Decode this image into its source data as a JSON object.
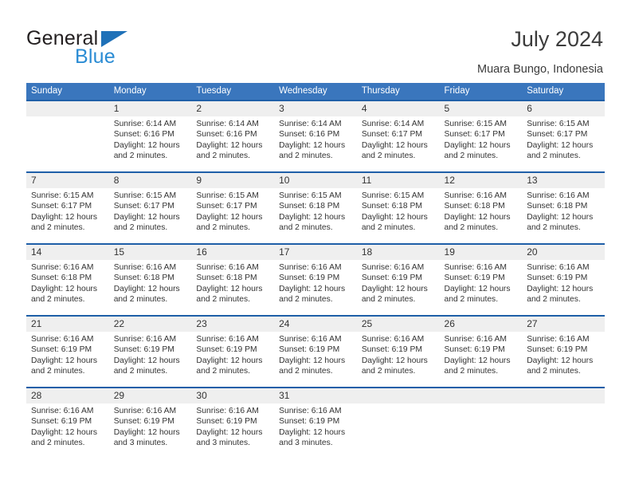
{
  "brand": {
    "name_top": "General",
    "name_bottom": "Blue",
    "triangle_icon": "blue-triangle-logo-mark",
    "color_dark": "#231f20",
    "color_blue": "#2b8cd4"
  },
  "header": {
    "title": "July 2024",
    "subtitle": "Muara Bungo, Indonesia"
  },
  "theme": {
    "header_bar": "#3a76bd",
    "cell_top_border": "#1f5fa8",
    "daynum_bg": "#efefef",
    "text": "#333333"
  },
  "calendar": {
    "weekday_headers": [
      "Sunday",
      "Monday",
      "Tuesday",
      "Wednesday",
      "Thursday",
      "Friday",
      "Saturday"
    ],
    "weeks": [
      [
        {
          "day": "",
          "blank": true,
          "lines": []
        },
        {
          "day": "1",
          "lines": [
            "Sunrise: 6:14 AM",
            "Sunset: 6:16 PM",
            "Daylight: 12 hours",
            "and 2 minutes."
          ]
        },
        {
          "day": "2",
          "lines": [
            "Sunrise: 6:14 AM",
            "Sunset: 6:16 PM",
            "Daylight: 12 hours",
            "and 2 minutes."
          ]
        },
        {
          "day": "3",
          "lines": [
            "Sunrise: 6:14 AM",
            "Sunset: 6:16 PM",
            "Daylight: 12 hours",
            "and 2 minutes."
          ]
        },
        {
          "day": "4",
          "lines": [
            "Sunrise: 6:14 AM",
            "Sunset: 6:17 PM",
            "Daylight: 12 hours",
            "and 2 minutes."
          ]
        },
        {
          "day": "5",
          "lines": [
            "Sunrise: 6:15 AM",
            "Sunset: 6:17 PM",
            "Daylight: 12 hours",
            "and 2 minutes."
          ]
        },
        {
          "day": "6",
          "lines": [
            "Sunrise: 6:15 AM",
            "Sunset: 6:17 PM",
            "Daylight: 12 hours",
            "and 2 minutes."
          ]
        }
      ],
      [
        {
          "day": "7",
          "lines": [
            "Sunrise: 6:15 AM",
            "Sunset: 6:17 PM",
            "Daylight: 12 hours",
            "and 2 minutes."
          ]
        },
        {
          "day": "8",
          "lines": [
            "Sunrise: 6:15 AM",
            "Sunset: 6:17 PM",
            "Daylight: 12 hours",
            "and 2 minutes."
          ]
        },
        {
          "day": "9",
          "lines": [
            "Sunrise: 6:15 AM",
            "Sunset: 6:17 PM",
            "Daylight: 12 hours",
            "and 2 minutes."
          ]
        },
        {
          "day": "10",
          "lines": [
            "Sunrise: 6:15 AM",
            "Sunset: 6:18 PM",
            "Daylight: 12 hours",
            "and 2 minutes."
          ]
        },
        {
          "day": "11",
          "lines": [
            "Sunrise: 6:15 AM",
            "Sunset: 6:18 PM",
            "Daylight: 12 hours",
            "and 2 minutes."
          ]
        },
        {
          "day": "12",
          "lines": [
            "Sunrise: 6:16 AM",
            "Sunset: 6:18 PM",
            "Daylight: 12 hours",
            "and 2 minutes."
          ]
        },
        {
          "day": "13",
          "lines": [
            "Sunrise: 6:16 AM",
            "Sunset: 6:18 PM",
            "Daylight: 12 hours",
            "and 2 minutes."
          ]
        }
      ],
      [
        {
          "day": "14",
          "lines": [
            "Sunrise: 6:16 AM",
            "Sunset: 6:18 PM",
            "Daylight: 12 hours",
            "and 2 minutes."
          ]
        },
        {
          "day": "15",
          "lines": [
            "Sunrise: 6:16 AM",
            "Sunset: 6:18 PM",
            "Daylight: 12 hours",
            "and 2 minutes."
          ]
        },
        {
          "day": "16",
          "lines": [
            "Sunrise: 6:16 AM",
            "Sunset: 6:18 PM",
            "Daylight: 12 hours",
            "and 2 minutes."
          ]
        },
        {
          "day": "17",
          "lines": [
            "Sunrise: 6:16 AM",
            "Sunset: 6:19 PM",
            "Daylight: 12 hours",
            "and 2 minutes."
          ]
        },
        {
          "day": "18",
          "lines": [
            "Sunrise: 6:16 AM",
            "Sunset: 6:19 PM",
            "Daylight: 12 hours",
            "and 2 minutes."
          ]
        },
        {
          "day": "19",
          "lines": [
            "Sunrise: 6:16 AM",
            "Sunset: 6:19 PM",
            "Daylight: 12 hours",
            "and 2 minutes."
          ]
        },
        {
          "day": "20",
          "lines": [
            "Sunrise: 6:16 AM",
            "Sunset: 6:19 PM",
            "Daylight: 12 hours",
            "and 2 minutes."
          ]
        }
      ],
      [
        {
          "day": "21",
          "lines": [
            "Sunrise: 6:16 AM",
            "Sunset: 6:19 PM",
            "Daylight: 12 hours",
            "and 2 minutes."
          ]
        },
        {
          "day": "22",
          "lines": [
            "Sunrise: 6:16 AM",
            "Sunset: 6:19 PM",
            "Daylight: 12 hours",
            "and 2 minutes."
          ]
        },
        {
          "day": "23",
          "lines": [
            "Sunrise: 6:16 AM",
            "Sunset: 6:19 PM",
            "Daylight: 12 hours",
            "and 2 minutes."
          ]
        },
        {
          "day": "24",
          "lines": [
            "Sunrise: 6:16 AM",
            "Sunset: 6:19 PM",
            "Daylight: 12 hours",
            "and 2 minutes."
          ]
        },
        {
          "day": "25",
          "lines": [
            "Sunrise: 6:16 AM",
            "Sunset: 6:19 PM",
            "Daylight: 12 hours",
            "and 2 minutes."
          ]
        },
        {
          "day": "26",
          "lines": [
            "Sunrise: 6:16 AM",
            "Sunset: 6:19 PM",
            "Daylight: 12 hours",
            "and 2 minutes."
          ]
        },
        {
          "day": "27",
          "lines": [
            "Sunrise: 6:16 AM",
            "Sunset: 6:19 PM",
            "Daylight: 12 hours",
            "and 2 minutes."
          ]
        }
      ],
      [
        {
          "day": "28",
          "lines": [
            "Sunrise: 6:16 AM",
            "Sunset: 6:19 PM",
            "Daylight: 12 hours",
            "and 2 minutes."
          ]
        },
        {
          "day": "29",
          "lines": [
            "Sunrise: 6:16 AM",
            "Sunset: 6:19 PM",
            "Daylight: 12 hours",
            "and 3 minutes."
          ]
        },
        {
          "day": "30",
          "lines": [
            "Sunrise: 6:16 AM",
            "Sunset: 6:19 PM",
            "Daylight: 12 hours",
            "and 3 minutes."
          ]
        },
        {
          "day": "31",
          "lines": [
            "Sunrise: 6:16 AM",
            "Sunset: 6:19 PM",
            "Daylight: 12 hours",
            "and 3 minutes."
          ]
        },
        {
          "day": "",
          "blank": true,
          "lines": []
        },
        {
          "day": "",
          "blank": true,
          "lines": []
        },
        {
          "day": "",
          "blank": true,
          "lines": []
        }
      ]
    ]
  }
}
